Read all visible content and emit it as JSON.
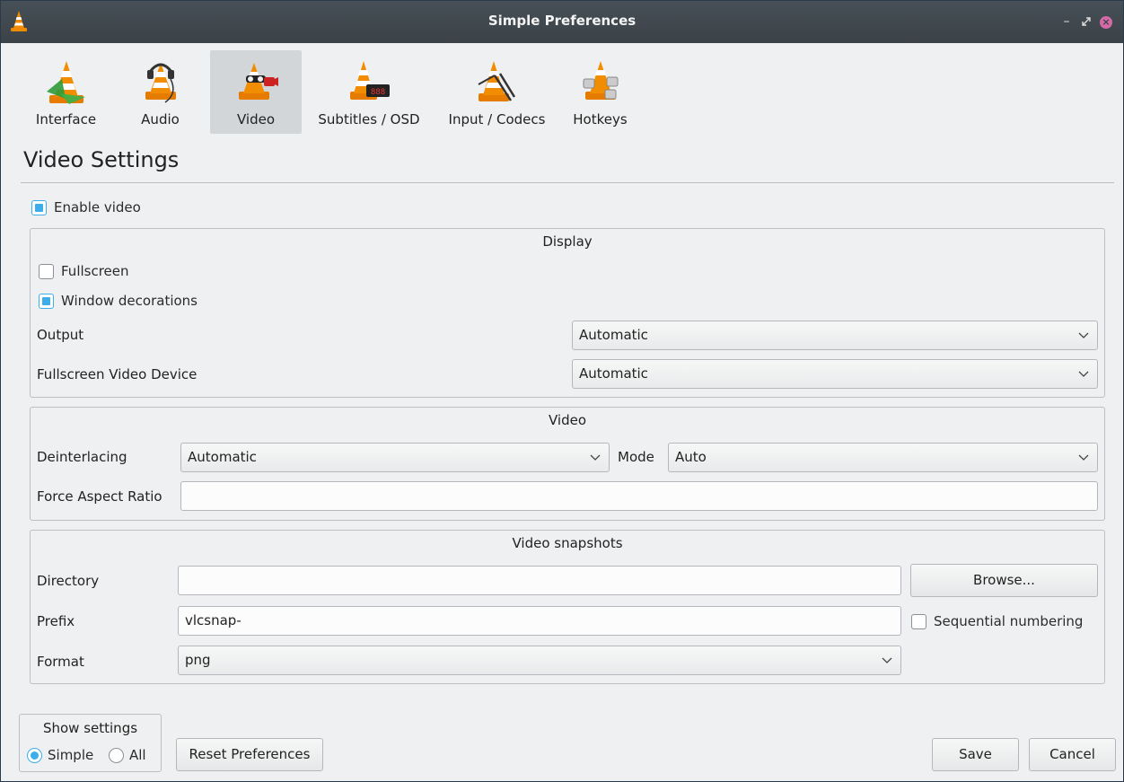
{
  "window": {
    "title": "Simple Preferences",
    "icon": "vlc-cone-icon"
  },
  "tabs": [
    {
      "label": "Interface",
      "icon": "interface-cone-icon",
      "active": false
    },
    {
      "label": "Audio",
      "icon": "audio-cone-icon",
      "active": false
    },
    {
      "label": "Video",
      "icon": "video-cone-icon",
      "active": true
    },
    {
      "label": "Subtitles / OSD",
      "icon": "subtitles-cone-icon",
      "active": false
    },
    {
      "label": "Input / Codecs",
      "icon": "input-codecs-cone-icon",
      "active": false
    },
    {
      "label": "Hotkeys",
      "icon": "hotkeys-cone-icon",
      "active": false
    }
  ],
  "section_title": "Video Settings",
  "enable_video": {
    "label": "Enable video",
    "checked": true
  },
  "display": {
    "title": "Display",
    "fullscreen": {
      "label": "Fullscreen",
      "checked": false
    },
    "window_decorations": {
      "label": "Window decorations",
      "checked": true
    },
    "output": {
      "label": "Output",
      "value": "Automatic"
    },
    "fullscreen_device": {
      "label": "Fullscreen Video Device",
      "value": "Automatic"
    }
  },
  "video": {
    "title": "Video",
    "deinterlacing": {
      "label": "Deinterlacing",
      "value": "Automatic"
    },
    "mode": {
      "label": "Mode",
      "value": "Auto"
    },
    "force_aspect": {
      "label": "Force Aspect Ratio",
      "value": ""
    }
  },
  "snapshots": {
    "title": "Video snapshots",
    "directory": {
      "label": "Directory",
      "value": ""
    },
    "browse_label": "Browse...",
    "prefix": {
      "label": "Prefix",
      "value": "vlcsnap-"
    },
    "sequential": {
      "label": "Sequential numbering",
      "checked": false
    },
    "format": {
      "label": "Format",
      "value": "png"
    }
  },
  "show_settings": {
    "title": "Show settings",
    "simple": {
      "label": "Simple",
      "selected": true
    },
    "all": {
      "label": "All",
      "selected": false
    }
  },
  "footer": {
    "reset_label": "Reset Preferences",
    "save_label": "Save",
    "cancel_label": "Cancel"
  },
  "colors": {
    "accent": "#3daee9",
    "titlebar": "#3b4248",
    "background": "#eff0f1",
    "cone_orange": "#f08a00"
  }
}
